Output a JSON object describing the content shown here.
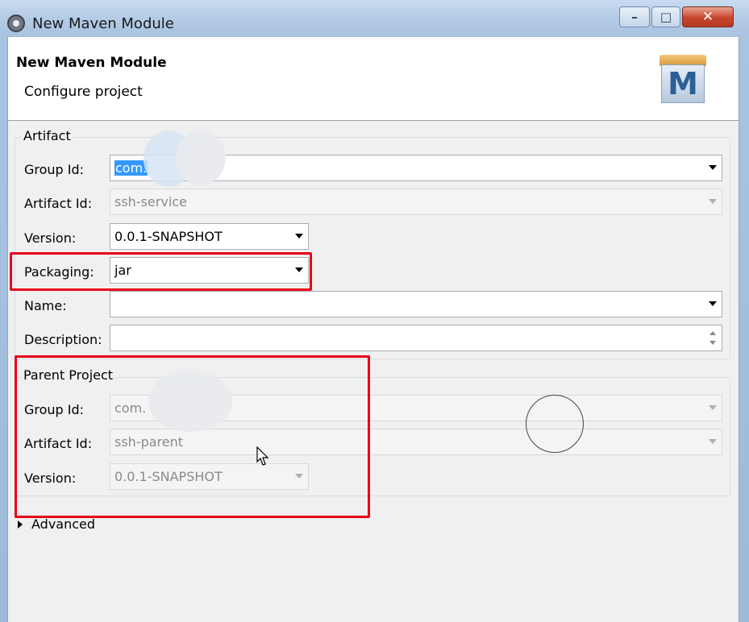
{
  "window": {
    "title": "New Maven Module",
    "min_glyph": "–",
    "max_glyph": "□",
    "close_glyph": "✕"
  },
  "header": {
    "title": "New Maven Module",
    "subtitle": "Configure project",
    "logo_letter": "M"
  },
  "artifact": {
    "group_label": "Artifact",
    "group_id": {
      "label": "Group Id:",
      "value": "com."
    },
    "artifact_id": {
      "label": "Artifact Id:",
      "value": "ssh-service"
    },
    "version": {
      "label": "Version:",
      "value": "0.0.1-SNAPSHOT"
    },
    "packaging": {
      "label": "Packaging:",
      "value": "jar"
    },
    "name": {
      "label": "Name:",
      "value": ""
    },
    "description": {
      "label": "Description:",
      "value": ""
    }
  },
  "parent": {
    "group_label": "Parent Project",
    "group_id": {
      "label": "Group Id:",
      "value": "com."
    },
    "artifact_id": {
      "label": "Artifact Id:",
      "value": "ssh-parent"
    },
    "version": {
      "label": "Version:",
      "value": "0.0.1-SNAPSHOT"
    }
  },
  "advanced": {
    "label": "Advanced",
    "expanded": false
  },
  "colors": {
    "highlight_red": "#e8001a",
    "selection_blue": "#3399ff",
    "dialog_bg": "#f0f0f0"
  }
}
